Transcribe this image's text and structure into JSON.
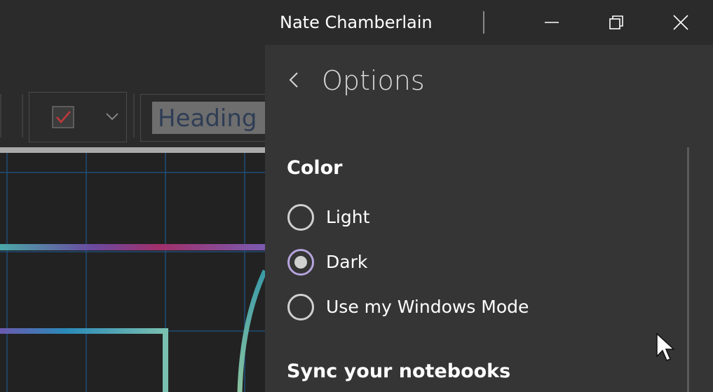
{
  "titlebar": {
    "user_name": "Nate Chamberlain",
    "minimize_icon": "minimize-icon",
    "restore_icon": "restore-icon",
    "close_icon": "close-icon"
  },
  "ribbon": {
    "style_label": "Heading",
    "tag_icon": "checkbox-icon",
    "dropdown_icon": "chevron-down-icon"
  },
  "options": {
    "title": "Options",
    "back_icon": "chevron-left-icon",
    "color_heading": "Color",
    "color_choices": [
      {
        "label": "Light",
        "selected": false
      },
      {
        "label": "Dark",
        "selected": true
      },
      {
        "label": "Use my Windows Mode",
        "selected": false
      }
    ],
    "sync_heading": "Sync your notebooks"
  },
  "colors": {
    "background": "#2b2b2b",
    "panel": "#353535",
    "accent": "#b6a4de",
    "canvas": "#222222",
    "gridline": "#1e4d78"
  }
}
